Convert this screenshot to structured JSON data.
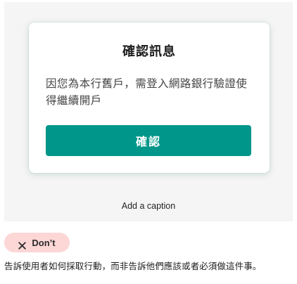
{
  "dialog": {
    "title": "確認訊息",
    "message": "因您為本行舊戶，需登入網路銀行驗證使得繼續開戶",
    "confirm_label": "確認"
  },
  "caption": "Add a caption",
  "badge": {
    "icon": "close-icon",
    "label": "Don’t"
  },
  "description": "告訴使用者如何採取行動，而非告訴他們應該或者必須做這件事。",
  "colors": {
    "primary": "#00968a",
    "badge_bg": "#fdd6d6",
    "figure_bg": "#f5f5f5"
  }
}
